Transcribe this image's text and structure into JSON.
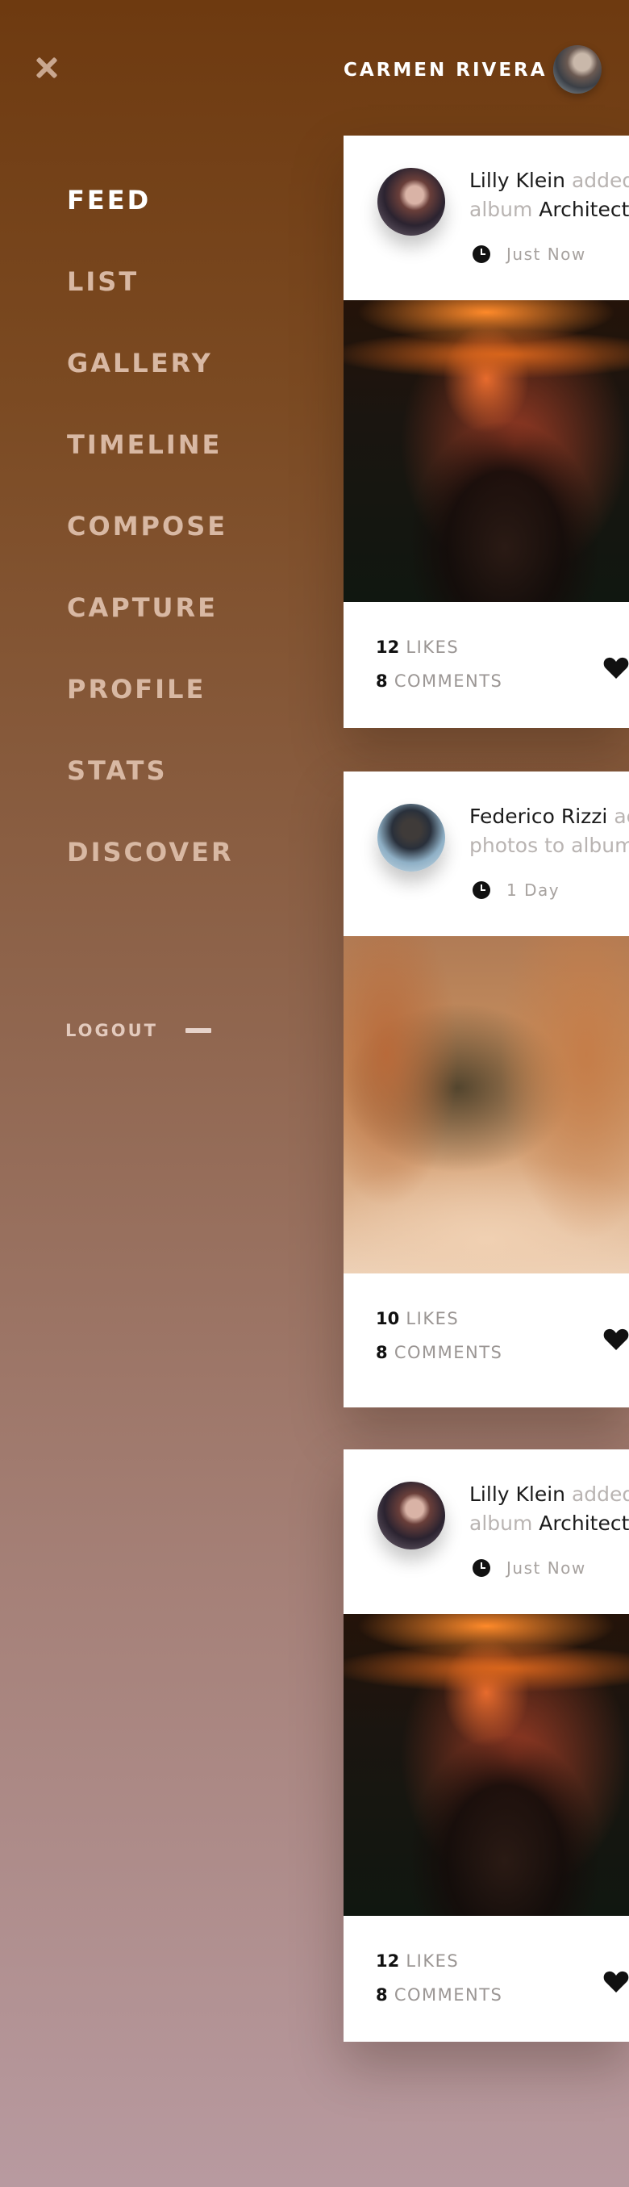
{
  "header": {
    "user_name": "CARMEN RIVERA"
  },
  "menu": {
    "items": [
      {
        "label": "FEED",
        "active": true
      },
      {
        "label": "LIST",
        "active": false
      },
      {
        "label": "GALLERY",
        "active": false
      },
      {
        "label": "TIMELINE",
        "active": false
      },
      {
        "label": "COMPOSE",
        "active": false
      },
      {
        "label": "CAPTURE",
        "active": false
      },
      {
        "label": "PROFILE",
        "active": false
      },
      {
        "label": "STATS",
        "active": false
      },
      {
        "label": "DISCOVER",
        "active": false
      }
    ],
    "logout_label": "LOGOUT"
  },
  "feed": {
    "posts": [
      {
        "author": "Lilly Klein",
        "action_line1": "added",
        "action_line2": "album",
        "album": "Architectu",
        "time": "Just Now",
        "likes_count": "12",
        "likes_label": "LIKES",
        "comments_count": "8",
        "comments_label": "COMMENTS"
      },
      {
        "author": "Federico Rizzi",
        "action_line1": "ac",
        "action_line2": "photos to album",
        "album": "",
        "time": "1 Day",
        "likes_count": "10",
        "likes_label": "LIKES",
        "comments_count": "8",
        "comments_label": "COMMENTS"
      },
      {
        "author": "Lilly Klein",
        "action_line1": "added",
        "action_line2": "album",
        "album": "Architectu",
        "time": "Just Now",
        "likes_count": "12",
        "likes_label": "LIKES",
        "comments_count": "8",
        "comments_label": "COMMENTS"
      }
    ]
  },
  "icons": {
    "close": "close-icon",
    "clock": "clock-icon",
    "heart": "heart-icon"
  },
  "colors": {
    "menu_active": "#ffffff",
    "menu_inactive": "#d8b8a3",
    "card_bg": "#ffffff"
  }
}
